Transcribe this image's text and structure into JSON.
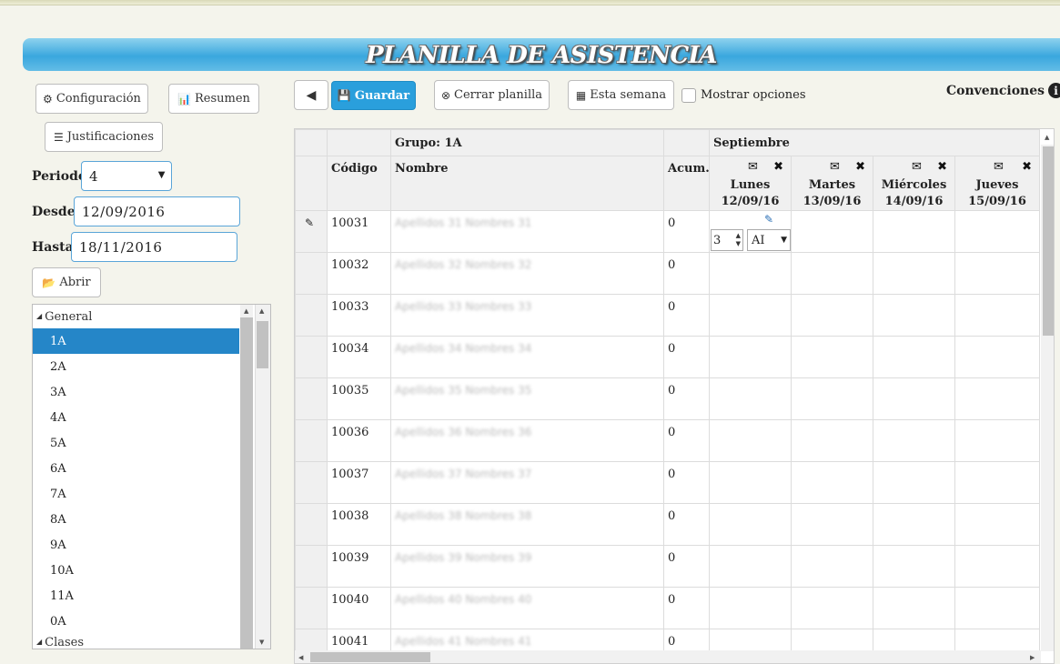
{
  "banner": {
    "title": "PLANILLA DE ASISTENCIA"
  },
  "sidebar": {
    "config_label": "Configuración",
    "summary_label": "Resumen",
    "justifications_label": "Justificaciones",
    "period_label": "Periodo",
    "period_value": "4",
    "from_label": "Desde",
    "from_value": "12/09/2016",
    "to_label": "Hasta",
    "to_value": "18/11/2016",
    "open_label": "Abrir",
    "tree": {
      "root_label": "General",
      "items": [
        "1A",
        "2A",
        "3A",
        "4A",
        "5A",
        "6A",
        "7A",
        "8A",
        "9A",
        "10A",
        "11A",
        "0A"
      ],
      "selected": "1A",
      "next_root_label": "Clases"
    }
  },
  "toolbar": {
    "save_label": "Guardar",
    "close_label": "Cerrar planilla",
    "week_label": "Esta semana",
    "show_options_label": "Mostrar opciones",
    "conventions_label": "Convenciones"
  },
  "grid": {
    "group_label": "Grupo: 1A",
    "month_label": "Septiembre",
    "col_code": "Código",
    "col_name": "Nombre",
    "col_acum": "Acum.",
    "days": [
      {
        "name": "Lunes",
        "date": "12/09/16"
      },
      {
        "name": "Martes",
        "date": "13/09/16"
      },
      {
        "name": "Miércoles",
        "date": "14/09/16"
      },
      {
        "name": "Jueves",
        "date": "15/09/16"
      }
    ],
    "first_row_hours": "3",
    "first_row_type": "AI",
    "rows": [
      {
        "code": "10031",
        "name": "Apellidos 31 Nombres 31",
        "acum": "0"
      },
      {
        "code": "10032",
        "name": "Apellidos 32 Nombres 32",
        "acum": "0"
      },
      {
        "code": "10033",
        "name": "Apellidos 33 Nombres 33",
        "acum": "0"
      },
      {
        "code": "10034",
        "name": "Apellidos 34 Nombres 34",
        "acum": "0"
      },
      {
        "code": "10035",
        "name": "Apellidos 35 Nombres 35",
        "acum": "0"
      },
      {
        "code": "10036",
        "name": "Apellidos 36 Nombres 36",
        "acum": "0"
      },
      {
        "code": "10037",
        "name": "Apellidos 37 Nombres 37",
        "acum": "0"
      },
      {
        "code": "10038",
        "name": "Apellidos 38 Nombres 38",
        "acum": "0"
      },
      {
        "code": "10039",
        "name": "Apellidos 39 Nombres 39",
        "acum": "0"
      },
      {
        "code": "10040",
        "name": "Apellidos 40 Nombres 40",
        "acum": "0"
      },
      {
        "code": "10041",
        "name": "Apellidos 41 Nombres 41",
        "acum": "0"
      }
    ]
  },
  "colors": {
    "banner": "#3aa7de",
    "primary": "#2a9fdc",
    "selected": "#2586c8"
  }
}
